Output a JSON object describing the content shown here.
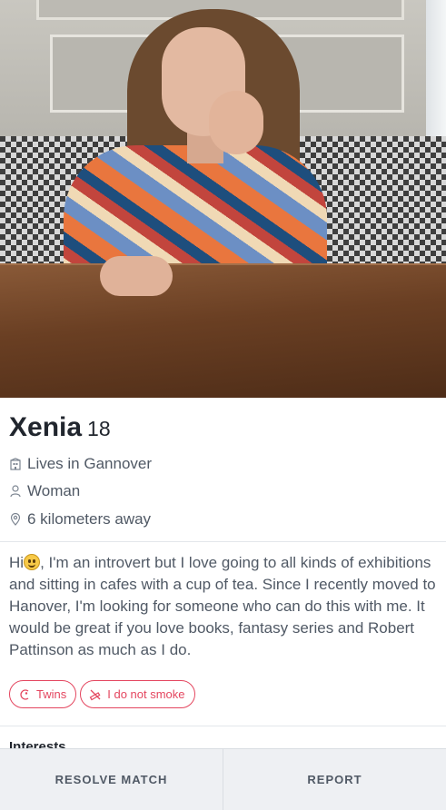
{
  "profile": {
    "name": "Xenia",
    "age": "18",
    "lives_in": "Lives in Gannover",
    "gender": "Woman",
    "distance": "6 kilometers away",
    "bio_before_emoji": "Hi",
    "bio_after_emoji": ", I'm an introvert but I love going to all kinds of exhibitions and sitting in cafes with a cup of tea. Since I recently moved to Hanover, I'm looking for someone who can do this with me. It would be great if you love books, fantasy series and Robert Pattinson as much as I do.",
    "tags": [
      {
        "label": "Twins",
        "icon": "zodiac-icon"
      },
      {
        "label": "I do not smoke",
        "icon": "no-smoking-icon"
      }
    ],
    "interests_heading": "Interests"
  },
  "footer": {
    "resolve_label": "RESOLVE MATCH",
    "report_label": "REPORT"
  },
  "colors": {
    "accent": "#e4465f",
    "text_primary": "#21262e",
    "text_secondary": "#505965",
    "footer_bg": "#eef0f3"
  }
}
